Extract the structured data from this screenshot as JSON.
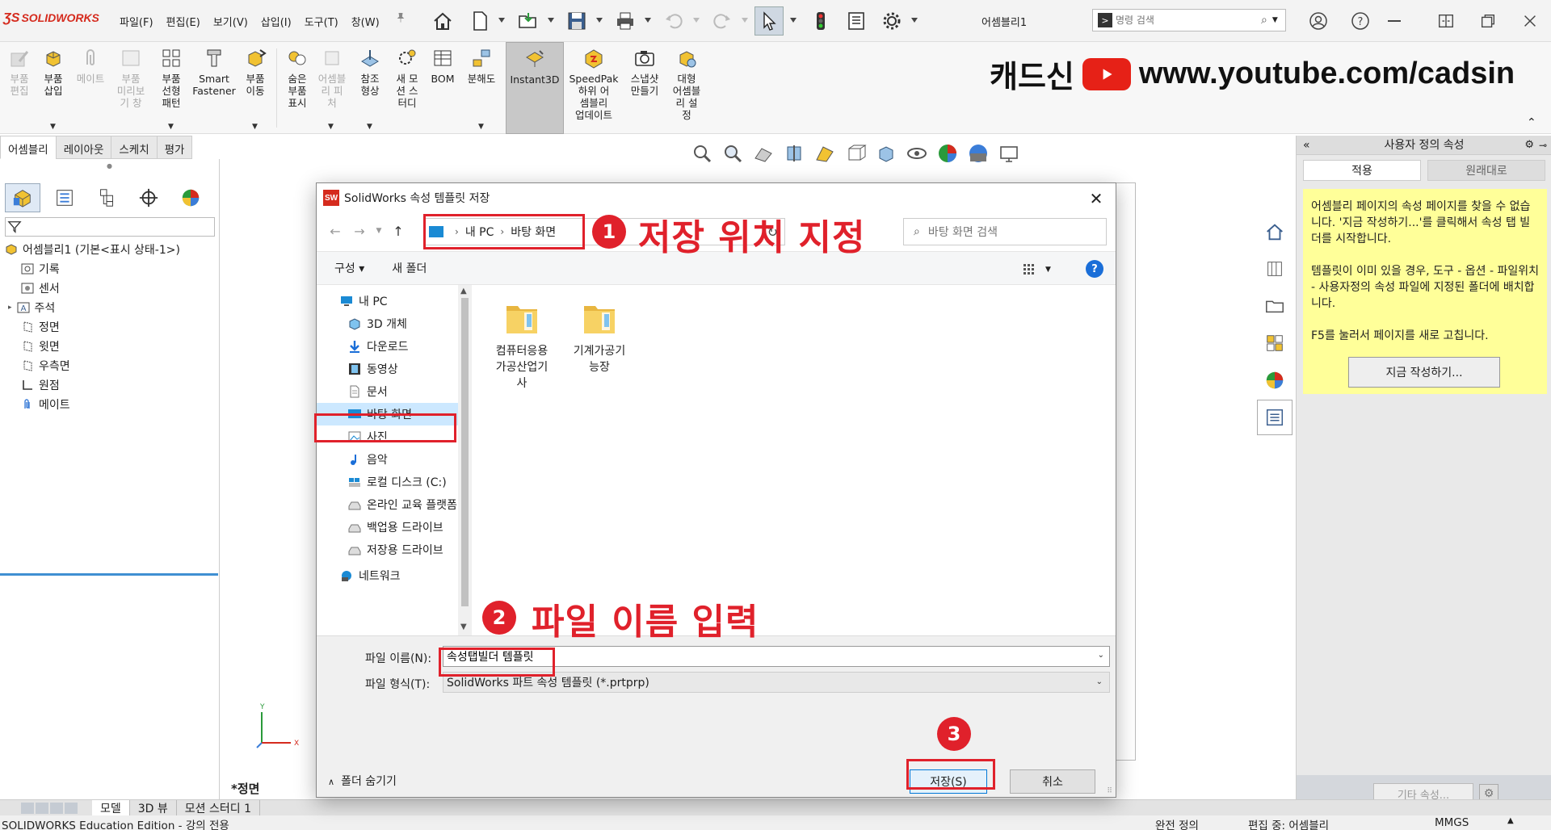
{
  "app": {
    "logo": "SOLIDWORKS",
    "menus": [
      "파일(F)",
      "편집(E)",
      "보기(V)",
      "삽입(I)",
      "도구(T)",
      "창(W)"
    ],
    "document_title": "어셈블리1",
    "command_search_placeholder": "명령 검색"
  },
  "banner": {
    "brand": "캐드신",
    "url": "www.youtube.com/cadsin"
  },
  "ribbon": {
    "buttons": [
      {
        "label": "부품\n편집",
        "enabled": false
      },
      {
        "label": "부품\n삽입",
        "enabled": true
      },
      {
        "label": "메이트",
        "enabled": false
      },
      {
        "label": "부품\n미리보\n기 창",
        "enabled": false
      },
      {
        "label": "부품\n선형\n패턴",
        "enabled": true
      },
      {
        "label": "Smart\nFastener",
        "enabled": true
      },
      {
        "label": "부품\n이동",
        "enabled": true
      },
      {
        "label": "숨은\n부품\n표시",
        "enabled": true
      },
      {
        "label": "어셈블\n리 피\n처",
        "enabled": false
      },
      {
        "label": "참조\n형상",
        "enabled": true
      },
      {
        "label": "새 모\n션 스\n터디",
        "enabled": true
      },
      {
        "label": "BOM",
        "enabled": true
      },
      {
        "label": "분해도",
        "enabled": true
      },
      {
        "label": "Instant3D",
        "enabled": true
      },
      {
        "label": "SpeedPak\n하위 어\n셈블리\n업데이트",
        "enabled": true
      },
      {
        "label": "스냅샷\n만들기",
        "enabled": true
      },
      {
        "label": "대형\n어셈블\n리 설\n정",
        "enabled": true
      }
    ]
  },
  "tabs": [
    "어셈블리",
    "레이아웃",
    "스케치",
    "평가"
  ],
  "feature_tree": {
    "root": "어셈블리1  (기본<표시 상태-1>)",
    "items": [
      "기록",
      "센서",
      "주석",
      "정면",
      "윗면",
      "우측면",
      "원점",
      "메이트"
    ]
  },
  "viewport": {
    "view_label": "*정면"
  },
  "right_panel": {
    "title": "사용자 정의 속성",
    "apply_button": "적용",
    "revert_button": "원래대로",
    "note_p1": "어셈블리 페이지의 속성 페이지를 찾을 수 없습니다. '지금 작성하기...'를 클릭해서 속성 탭 빌더를 시작합니다.",
    "note_p2": "템플릿이 이미 있을 경우, 도구 - 옵션 - 파일위치 - 사용자정의 속성 파일에 지정된 폴더에 배치합니다.",
    "note_p3": "F5를 눌러서 페이지를 새로 고칩니다.",
    "create_now_button": "지금 작성하기...",
    "other_props_button": "기타 속성..."
  },
  "bottom_tabs": [
    "모델",
    "3D 뷰",
    "모션 스터디 1"
  ],
  "status": {
    "edition": "SOLIDWORKS Education Edition - 강의 전용",
    "definition": "완전 정의",
    "editing": "편집 중: 어셈블리",
    "units": "MMGS"
  },
  "dialog": {
    "title": "SolidWorks 속성 템플릿 저장",
    "breadcrumb": [
      "내 PC",
      "바탕 화면"
    ],
    "search_placeholder": "바탕 화면 검색",
    "organize": "구성 ▾",
    "new_folder": "새 폴더",
    "nav_items": [
      "내 PC",
      "3D 개체",
      "다운로드",
      "동영상",
      "문서",
      "바탕 화면",
      "사진",
      "음악",
      "로컬 디스크 (C:)",
      "온라인 교육 플랫폼",
      "백업용 드라이브",
      "저장용 드라이브",
      "네트워크"
    ],
    "selected_nav": "바탕 화면",
    "folders": [
      "컴퓨터응용\n가공산업기\n사",
      "기계가공기\n능장"
    ],
    "filename_label": "파일 이름(N):",
    "filename_value": "속성탭빌더 템플릿",
    "filetype_label": "파일 형식(T):",
    "filetype_value": "SolidWorks 파트 속성 템플릿 (*.prtprp)",
    "hide_folders": "폴더 숨기기",
    "save_button": "저장(S)",
    "cancel_button": "취소"
  },
  "annotations": {
    "step1_number": "1",
    "step1_text": "저장 위치 지정",
    "step2_number": "2",
    "step2_text": "파일 이름 입력",
    "step3_number": "3"
  },
  "colors": {
    "annotation": "#e0212b",
    "solidworks_red": "#d52b1e",
    "note_bg": "#ffff99",
    "selection": "#cce8ff"
  }
}
